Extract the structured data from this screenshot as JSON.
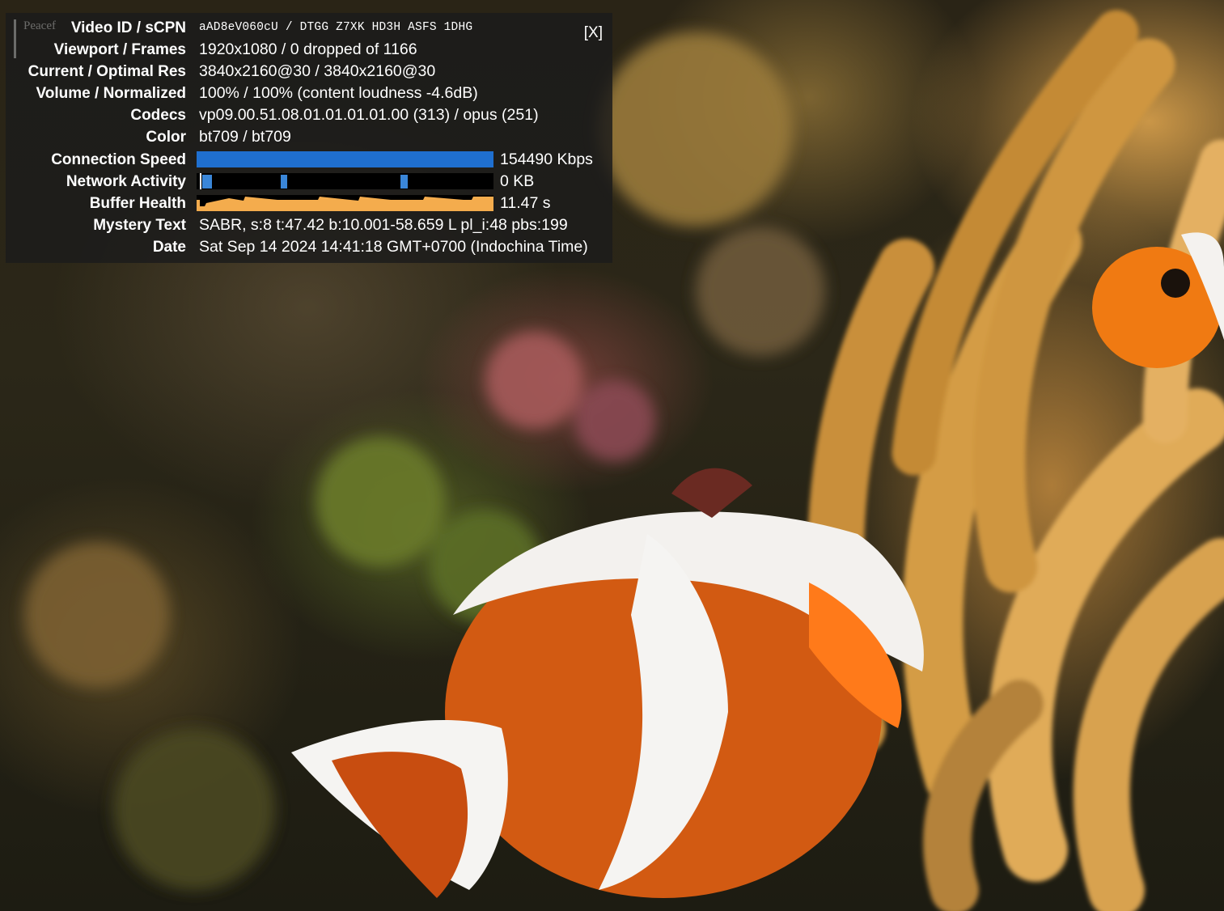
{
  "overlay_ghost_title": "Peacef",
  "stats": {
    "close_label": "[X]",
    "rows": [
      {
        "label": "Video ID / sCPN",
        "value": "aAD8eV060cU / DTGG Z7XK HD3H ASFS 1DHG"
      },
      {
        "label": "Viewport / Frames",
        "value": "1920x1080 / 0 dropped of 1166"
      },
      {
        "label": "Current / Optimal Res",
        "value": "3840x2160@30 / 3840x2160@30"
      },
      {
        "label": "Volume / Normalized",
        "value": "100% / 100% (content loudness -4.6dB)"
      },
      {
        "label": "Codecs",
        "value": "vp09.00.51.08.01.01.01.01.00 (313) / opus (251)"
      },
      {
        "label": "Color",
        "value": "bt709 / bt709"
      }
    ],
    "connection": {
      "label": "Connection Speed",
      "value": "154490 Kbps",
      "fill": 1.0,
      "color": "#1f6fcf"
    },
    "network": {
      "label": "Network Activity",
      "value": "0 KB",
      "color": "#3a86d8"
    },
    "buffer": {
      "label": "Buffer Health",
      "value": "11.47 s",
      "color": "#f4ac4d"
    },
    "rows2": [
      {
        "label": "Mystery Text",
        "value": "SABR, s:8 t:47.42 b:10.001-58.659 L pl_i:48 pbs:199"
      },
      {
        "label": "Date",
        "value": "Sat Sep 14 2024 14:41:18 GMT+0700 (Indochina Time)"
      }
    ]
  }
}
